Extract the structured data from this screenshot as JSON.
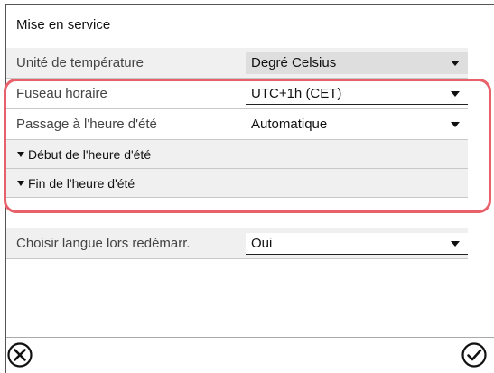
{
  "window": {
    "title": "Mise en service"
  },
  "settings": [
    {
      "label": "Unité de température",
      "value": "Degré Celsius"
    },
    {
      "label": "Fuseau horaire",
      "value": "UTC+1h (CET)"
    },
    {
      "label": "Passage à l'heure d'été",
      "value": "Automatique"
    }
  ],
  "sections": [
    {
      "label": "Début de l'heure d'été"
    },
    {
      "label": "Fin de l'heure d'été"
    }
  ],
  "language": {
    "label": "Choisir langue lors redémarr.",
    "value": "Oui"
  },
  "footer": {
    "cancel_icon": "close-circle-icon",
    "confirm_icon": "checkmark-circle-icon"
  },
  "colors": {
    "highlight": "#e8606a"
  }
}
